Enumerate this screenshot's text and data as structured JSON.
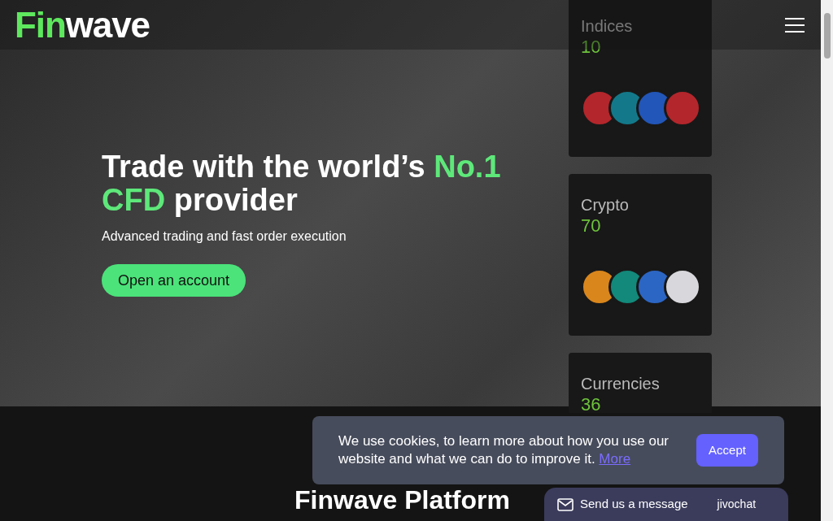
{
  "header": {
    "logo": {
      "accent": "Fin",
      "rest": "wave"
    }
  },
  "hero": {
    "headline": [
      {
        "text": "Trade with the world’s ",
        "highlight": false
      },
      {
        "text": "No.1",
        "highlight": true
      },
      {
        "text": "CFD",
        "highlight": true,
        "break": true
      },
      {
        "text": " provider",
        "highlight": false
      }
    ],
    "subtitle": "Advanced trading and fast order execution",
    "cta": "Open an account"
  },
  "markets": [
    {
      "title": "Indices",
      "count": "10",
      "coins": [
        {
          "color": "#b3262b"
        },
        {
          "color": "#13798a"
        },
        {
          "color": "#2256b8"
        },
        {
          "color": "#b3262b"
        }
      ]
    },
    {
      "title": "Crypto",
      "count": "70",
      "coins": [
        {
          "color": "#d9861c"
        },
        {
          "color": "#12897a"
        },
        {
          "color": "#2c66c4"
        },
        {
          "color": "#d8d8dc"
        }
      ]
    },
    {
      "title": "Currencies",
      "count": "36"
    }
  ],
  "section_title": "Finwave Platform",
  "cookie_banner": {
    "text": "We use cookies, to learn more about how you use our website and what we can do to improve it.",
    "link": "More",
    "button": "Accept"
  },
  "chat": {
    "label": "Send us a message",
    "brand": "jivochat"
  }
}
